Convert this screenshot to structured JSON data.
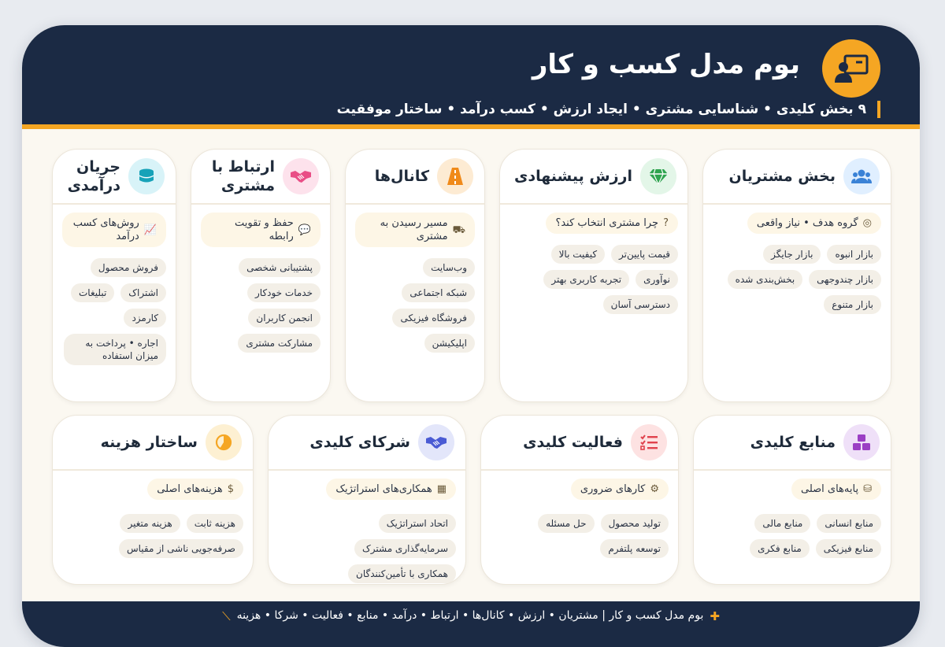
{
  "header": {
    "title": "بوم مدل کسب و کار",
    "subtitle": "۹ بخش کلیدی • شناسایی مشتری • ایجاد ارزش • کسب درآمد • ساختار موفقیت",
    "logo_icon": "presentation-board-icon"
  },
  "cards": {
    "segments": {
      "title": "بخش مشتریان",
      "icon": "users-icon",
      "section": "گروه هدف • نیاز واقعی",
      "tags": [
        "بازار انبوه",
        "بازار جایگز",
        "بازار چندوجهی",
        "بخش‌بندی شده",
        "بازار متنوع"
      ]
    },
    "value": {
      "title": "ارزش پیشنهادی",
      "icon": "gem-icon",
      "section": "چرا مشتری انتخاب کند؟",
      "tags": [
        "قیمت پایین‌تر",
        "کیفیت بالا",
        "نوآوری",
        "تجربه کاربری بهتر",
        "دسترسی آسان"
      ]
    },
    "channels": {
      "title": "کانال‌ها",
      "icon": "road-icon",
      "section": "مسیر رسیدن به مشتری",
      "tags": [
        "وب‌سایت",
        "شبکه اجتماعی",
        "فروشگاه فیزیکی",
        "اپلیکیشن"
      ]
    },
    "relations": {
      "title": "ارتباط با مشتری",
      "icon": "handshake-icon",
      "section": "حفظ و تقویت رابطه",
      "tags": [
        "پشتیبانی شخصی",
        "خدمات خودکار",
        "انجمن کاربران",
        "مشارکت مشتری"
      ]
    },
    "revenue": {
      "title": "جریان درآمدی",
      "icon": "coins-icon",
      "section": "روش‌های کسب درآمد",
      "tags": [
        "فروش محصول",
        "اشتراک",
        "تبلیغات",
        "کارمزد",
        "اجاره • پرداخت به میزان استفاده"
      ]
    },
    "resources": {
      "title": "منابع کلیدی",
      "icon": "cubes-icon",
      "section": "پایه‌های اصلی",
      "tags": [
        "منابع انسانی",
        "منابع مالی",
        "منابع فیزیکی",
        "منابع فکری"
      ]
    },
    "activities": {
      "title": "فعالیت کلیدی",
      "icon": "list-check-icon",
      "section": "کارهای ضروری",
      "tags": [
        "تولید محصول",
        "حل مسئله",
        "توسعه پلتفرم"
      ]
    },
    "partners": {
      "title": "شرکای کلیدی",
      "icon": "handshake-icon",
      "section": "همکاری‌های استراتژیک",
      "tags": [
        "اتحاد استراتژیک",
        "سرمایه‌گذاری مشترک",
        "همکاری با تأمین‌کنندگان"
      ]
    },
    "costs": {
      "title": "ساختار هزینه",
      "icon": "pie-chart-icon",
      "section": "هزینه‌های اصلی",
      "tags": [
        "هزینه ثابت",
        "هزینه متغیر",
        "صرفه‌جویی ناشی از مقیاس"
      ]
    }
  },
  "footer": {
    "text": "بوم مدل کسب و کار | مشتریان • ارزش • کانال‌ها • ارتباط • درآمد • منابع • فعالیت • شرکا • هزینه",
    "left_icon": "chart-line-icon",
    "right_icon": "puzzle-icon"
  },
  "colors": {
    "header_bg": "#1b2a44",
    "accent": "#f5a623",
    "canvas_bg": "#fbf8f1"
  }
}
